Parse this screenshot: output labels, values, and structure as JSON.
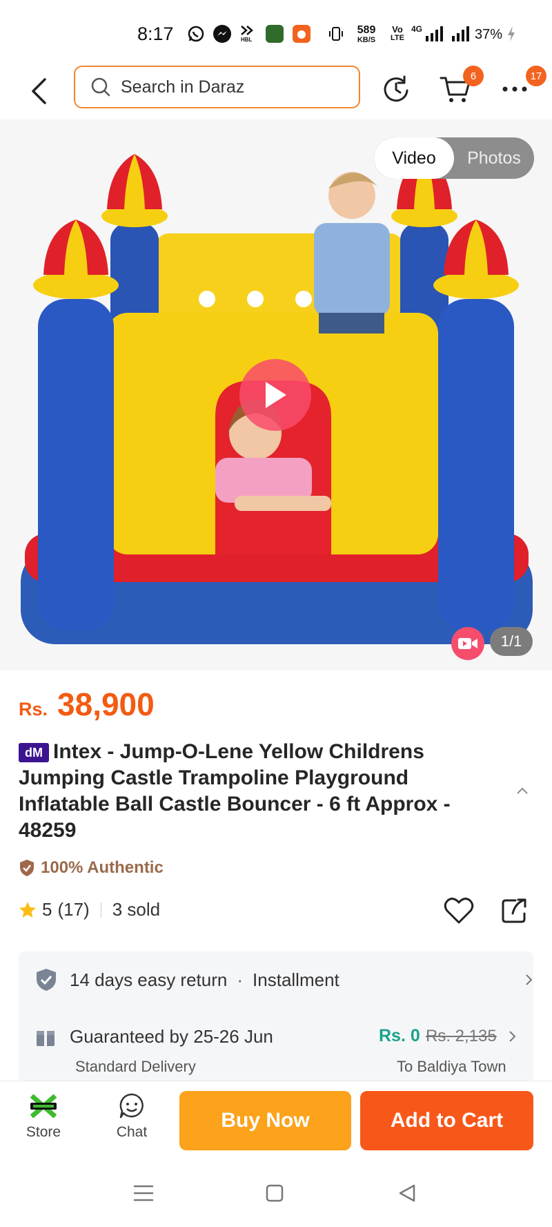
{
  "status_bar": {
    "time": "8:17",
    "net_speed_value": "589",
    "net_speed_unit": "KB/S",
    "volte": "Vo",
    "volte2": "LTE",
    "network": "4G",
    "battery": "37%",
    "app_icons": [
      "whatsapp-icon",
      "messenger-icon",
      "hbl-icon",
      "jazzcash-icon",
      "daraz-icon"
    ],
    "hbl_label": "HBL"
  },
  "top_nav": {
    "search_placeholder": "Search in Daraz",
    "cart_badge": "6",
    "more_badge": "17",
    "accent_color": "#f1862f"
  },
  "media": {
    "tabs": [
      {
        "label": "Video",
        "active": true
      },
      {
        "label": "Photos",
        "active": false
      }
    ],
    "counter": "1/1"
  },
  "product": {
    "currency": "Rs.",
    "price": "38,900",
    "brand_badge": "dM",
    "title": "Intex - Jump-O-Lene Yellow Childrens Jumping Castle Trampoline Playground Inflatable Ball Castle Bouncer - 6 ft Approx - 48259",
    "authentic_label": "100% Authentic",
    "rating": "5",
    "rating_count": "(17)",
    "sold": "3 sold"
  },
  "services": {
    "return_label": "14 days easy return",
    "installment_label": "Installment",
    "delivery_label": "Guaranteed by 25-26 Jun",
    "delivery_type": "Standard Delivery",
    "delivery_fee": "Rs. 0",
    "delivery_old_fee": "Rs. 2,135",
    "delivery_location": "To Baldiya Town"
  },
  "action_bar": {
    "store_label": "Store",
    "chat_label": "Chat",
    "buy_now_label": "Buy Now",
    "add_to_cart_label": "Add to Cart",
    "buy_color": "#fca21b",
    "cart_color": "#f8571a"
  }
}
